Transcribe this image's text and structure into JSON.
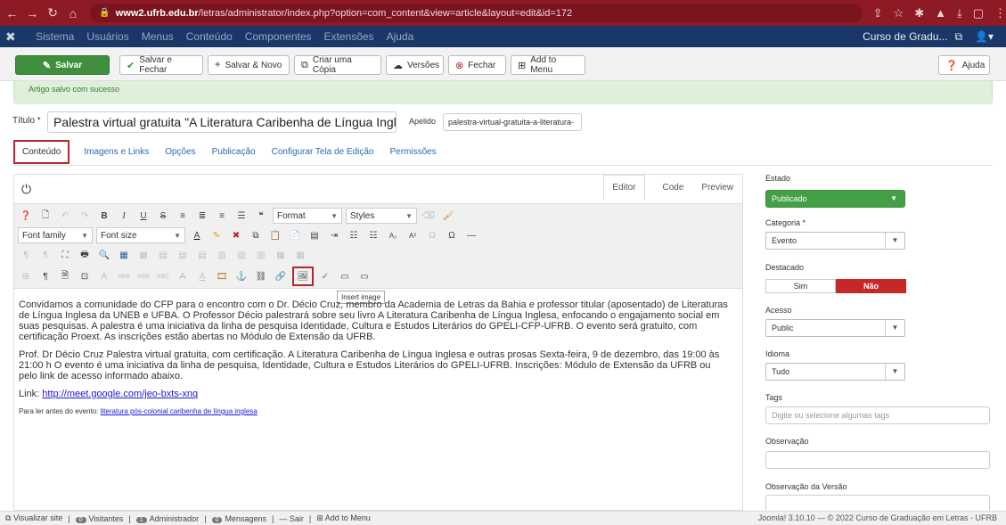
{
  "browser": {
    "url_host": "www2.ufrb.edu.br",
    "url_path": "/letras/administrator/index.php?option=com_content&view=article&layout=edit&id=172"
  },
  "admin_nav": {
    "items": [
      "Sistema",
      "Usuários",
      "Menus",
      "Conteúdo",
      "Componentes",
      "Extensões",
      "Ajuda"
    ],
    "site_name": "Curso de Gradu..."
  },
  "toolbar": {
    "save": "Salvar",
    "save_close": "Salvar e Fechar",
    "save_new": "Salvar & Novo",
    "save_copy": "Criar uma Cópia",
    "versions": "Versões",
    "close": "Fechar",
    "add_menu": "Add to Menu",
    "help": "Ajuda"
  },
  "message": "Artigo salvo com sucesso",
  "form": {
    "title_label": "Título *",
    "title_value": "Palestra virtual gratuita \"A Literatura Caribenha de Língua Inglesa\"",
    "alias_label": "Apelido",
    "alias_value": "palestra-virtual-gratuita-a-literatura-"
  },
  "tabs": [
    "Conteúdo",
    "Imagens e Links",
    "Opções",
    "Publicação",
    "Configurar Tela de Edição",
    "Permissões"
  ],
  "editor": {
    "tabs": [
      "Editor",
      "Code",
      "Preview"
    ],
    "format_label": "Format",
    "styles_label": "Styles",
    "font_family": "Font family",
    "font_size": "Font size",
    "tooltip": "Insert image",
    "paragraphs": [
      "Convidamos a comunidade do CFP para o encontro com o Dr. Décio Cruz, membro da Academia de Letras da Bahia e professor titular (aposentado) de Literaturas de Língua Inglesa da UNEB e UFBA. O Professor Décio palestrará sobre seu livro A Literatura Caribenha de Língua Inglesa, enfocando o engajamento social em suas pesquisas. A palestra é uma iniciativa da linha de pesquisa Identidade, Cultura e Estudos Literários do GPELI-CFP-UFRB. O evento será gratuito, com certificação Proext. As inscrições estão abertas no Módulo de Extensão da UFRB.",
      "Prof. Dr Décio Cruz Palestra virtual gratuita, com certificação. A Literatura Caribenha de Língua Inglesa e outras prosas Sexta-feira, 9 de dezembro, das 19:00 às 21:00 h O evento é uma iniciativa da linha de pesquisa, Identidade, Cultura e Estudos Literários do GPELI-UFRB. Inscrições: Módulo de Extensão da UFRB ou pelo link de acesso informado abaixo."
    ],
    "link_prefix": "Link: ",
    "link_text": "http://meet.google.com/jeo-bxts-xnq",
    "read_prefix": "Para ler antes do evento: ",
    "read_link": "literatura pós-colonial caribenha de língua inglesa"
  },
  "sidebar": {
    "estado_label": "Estado",
    "estado_value": "Publicado",
    "categoria_label": "Categoria *",
    "categoria_value": "Evento",
    "destacado_label": "Destacado",
    "sim": "Sim",
    "nao": "Não",
    "acesso_label": "Acesso",
    "acesso_value": "Public",
    "idioma_label": "Idioma",
    "idioma_value": "Tudo",
    "tags_label": "Tags",
    "tags_placeholder": "Digite ou selecione algumas tags",
    "obs_label": "Observação",
    "obs_versao_label": "Observação da Versão"
  },
  "footer": {
    "visualizar": "Visualizar site",
    "visitantes_count": "0",
    "visitantes": "Visitantes",
    "admin_count": "1",
    "admin": "Administrador",
    "msgs_count": "0",
    "msgs": "Mensagens",
    "sair": "Sair",
    "add_menu": "Add to Menu",
    "copyright": "Joomla! 3.10.10 — © 2022 Curso de Graduação em Letras - UFRB"
  },
  "colors": {
    "chrome": "#8e1a26",
    "admin_nav": "#1a3867",
    "save_green": "#3f8f3f",
    "published_green": "#43a047",
    "nao_red": "#c62828",
    "highlight_red": "#b3262e"
  }
}
